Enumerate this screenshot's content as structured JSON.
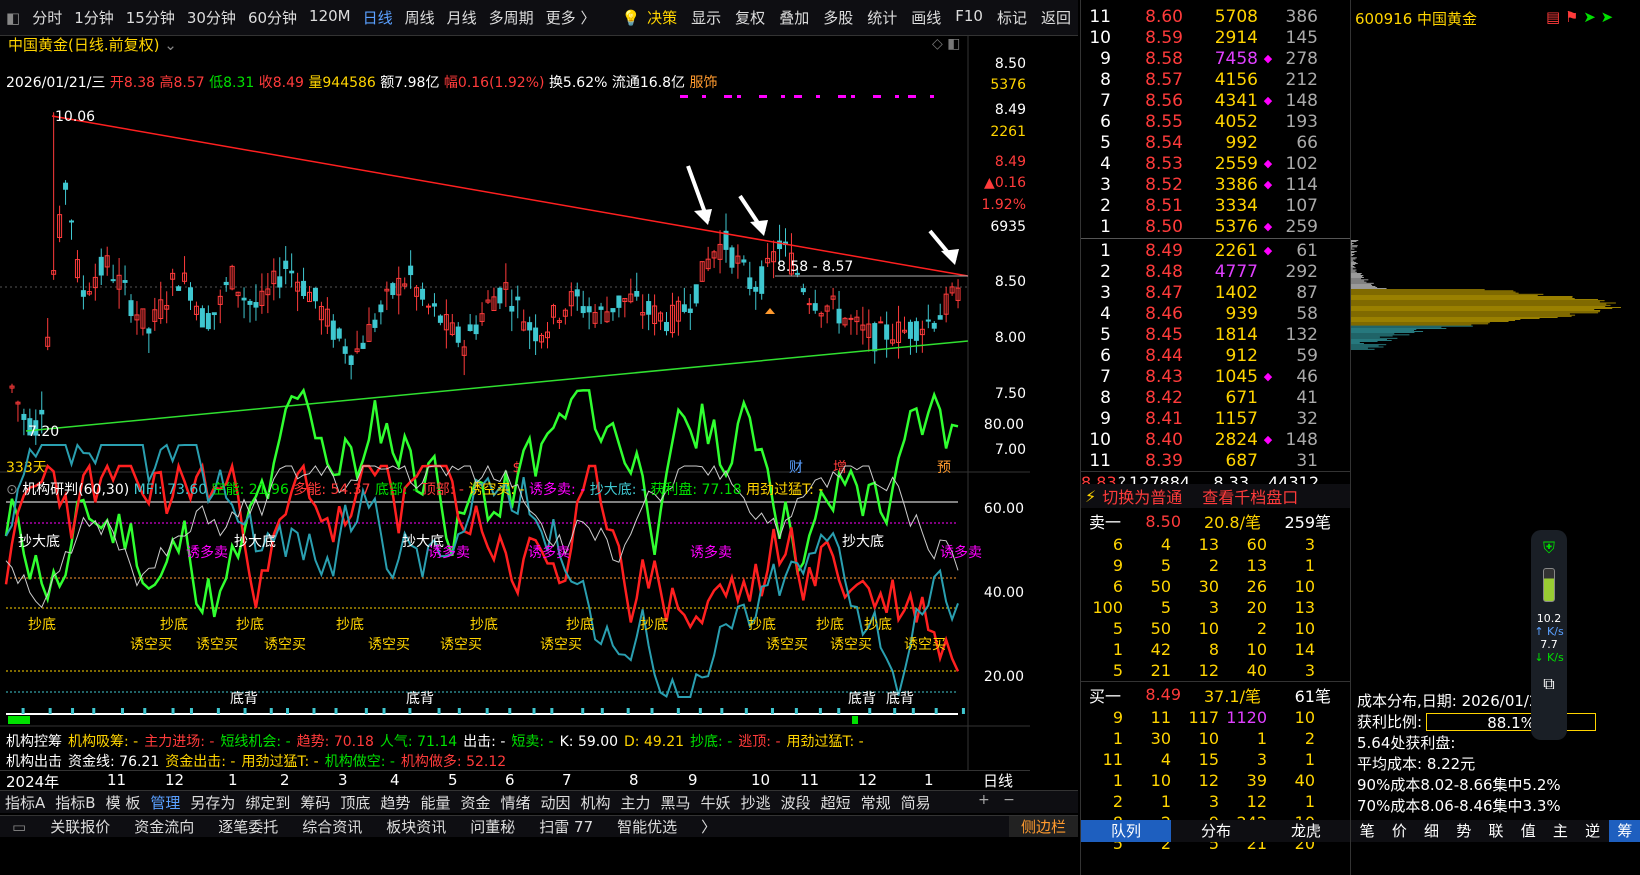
{
  "toolbar": {
    "periods": [
      "分时",
      "1分钟",
      "15分钟",
      "30分钟",
      "60分钟",
      "120M",
      "日线",
      "周线",
      "月线",
      "多周期",
      "更多 〉"
    ],
    "active": "日线",
    "right": [
      "决策",
      "显示",
      "复权",
      "叠加",
      "多股",
      "统计",
      "画线",
      "F10",
      "标记",
      "返回"
    ]
  },
  "chart_title": "中国黄金(日线.前复权)",
  "ohlc": {
    "date": "2026/01/21/三",
    "open": "开8.38",
    "high": "高8.57",
    "low": "低8.31",
    "close": "收8.49",
    "vol": "量944586",
    "amt": "额7.98亿",
    "chg": "幅0.16(1.92%)",
    "turn": "换5.62%",
    "float": "流通16.8亿",
    "sector": "服饰"
  },
  "annotations": {
    "high": "10.06",
    "low": "7.20",
    "range": "8.58 - 8.57",
    "days": "333天",
    "markers": [
      "$",
      "财",
      "增",
      "预"
    ]
  },
  "price_axis": [
    "8.50",
    "5376",
    "8.49",
    "2261",
    "8.49",
    "▲0.16",
    "1.92%",
    "6935",
    "8.50",
    "8.00",
    "7.50",
    "7.00"
  ],
  "sub1": {
    "name": "机构研判(60,30)",
    "mfi": "MFI: 73.60",
    "kong": "空能: 21.96",
    "duo": "多能: 54.37",
    "di": "底部: -",
    "ding": "顶部: -",
    "ykm": "诱空买: -",
    "ydm": "诱多卖: -",
    "cdd": "抄大底: -",
    "hlp": "获利盘: 77.18",
    "ygm": "用劲过猛T: -",
    "axis": [
      "80.00",
      "60.00",
      "40.00",
      "20.00"
    ],
    "labels": {
      "cdd": "抄大底",
      "ydm": "诱多卖",
      "cd": "抄底",
      "ykm": "诱空买",
      "db": "底背"
    }
  },
  "sub2": {
    "l1": [
      "机构控筹",
      "机构吸筹: -",
      "主力进场: -",
      "短线机会: -",
      "趋势: 70.18",
      "人气: 71.14",
      "出击: -",
      "短卖: -",
      "K: 59.00",
      "D: 49.21",
      "抄底: -",
      "逃顶: -",
      "用劲过猛T: -"
    ],
    "l2": [
      "机构出击",
      "资金线: 76.21",
      "资金出击: -",
      "用劲过猛T: -",
      "机构做空: -",
      "机构做多: 52.12"
    ]
  },
  "time_axis": [
    "2024年",
    "11",
    "12",
    "1",
    "2",
    "3",
    "4",
    "5",
    "6",
    "7",
    "8",
    "9",
    "10",
    "11",
    "12",
    "1"
  ],
  "period_label": "日线",
  "bottom_tabs": [
    "指标A",
    "指标B",
    "模 板",
    "管理",
    "另存为",
    "绑定到",
    "筹码",
    "顶底",
    "趋势",
    "能量",
    "资金",
    "情绪",
    "动因",
    "机构",
    "主力",
    "黑马",
    "牛妖",
    "抄逃",
    "波段",
    "超短",
    "常规",
    "简易"
  ],
  "bottom_bar": [
    "关联报价",
    "资金流向",
    "逐笔委托",
    "综合资讯",
    "板块资讯",
    "问董秘",
    "扫雷 77",
    "智能优选",
    "〉",
    "侧边栏"
  ],
  "asks": [
    [
      "11",
      "8.60",
      "5708",
      "",
      "386"
    ],
    [
      "10",
      "8.59",
      "2914",
      "",
      "145"
    ],
    [
      "9",
      "8.58",
      "7458",
      "◆",
      "278"
    ],
    [
      "8",
      "8.57",
      "4156",
      "",
      "212"
    ],
    [
      "7",
      "8.56",
      "4341",
      "◆",
      "148"
    ],
    [
      "6",
      "8.55",
      "4052",
      "",
      "193"
    ],
    [
      "5",
      "8.54",
      "992",
      "",
      "66"
    ],
    [
      "4",
      "8.53",
      "2559",
      "◆",
      "102"
    ],
    [
      "3",
      "8.52",
      "3386",
      "◆",
      "114"
    ],
    [
      "2",
      "8.51",
      "3334",
      "",
      "107"
    ],
    [
      "1",
      "8.50",
      "5376",
      "◆",
      "259"
    ]
  ],
  "bids": [
    [
      "1",
      "8.49",
      "2261",
      "◆",
      "61"
    ],
    [
      "2",
      "8.48",
      "4777",
      "",
      "292"
    ],
    [
      "3",
      "8.47",
      "1402",
      "",
      "87"
    ],
    [
      "4",
      "8.46",
      "939",
      "",
      "58"
    ],
    [
      "5",
      "8.45",
      "1814",
      "",
      "132"
    ],
    [
      "6",
      "8.44",
      "912",
      "",
      "59"
    ],
    [
      "7",
      "8.43",
      "1045",
      "◆",
      "46"
    ],
    [
      "8",
      "8.42",
      "671",
      "",
      "41"
    ],
    [
      "9",
      "8.41",
      "1157",
      "",
      "32"
    ],
    [
      "10",
      "8.40",
      "2824",
      "◆",
      "148"
    ],
    [
      "11",
      "8.39",
      "687",
      "",
      "31"
    ]
  ],
  "book_footer": [
    "8.83",
    "?",
    "127884",
    "8.33",
    "44312"
  ],
  "switch": {
    "a": "切换为普通",
    "b": "查看千档盘口"
  },
  "sell1": {
    "label": "卖一",
    "price": "8.50",
    "per": "20.8/笔",
    "cnt": "259笔"
  },
  "sell_rows": [
    [
      "6",
      "4",
      "13",
      "60",
      "3"
    ],
    [
      "9",
      "5",
      "2",
      "13",
      "1"
    ],
    [
      "6",
      "50",
      "30",
      "26",
      "10"
    ],
    [
      "100",
      "5",
      "3",
      "20",
      "13"
    ],
    [
      "5",
      "50",
      "10",
      "2",
      "10"
    ],
    [
      "1",
      "42",
      "8",
      "10",
      "14"
    ],
    [
      "5",
      "21",
      "12",
      "40",
      "3"
    ]
  ],
  "buy1": {
    "label": "买一",
    "price": "8.49",
    "per": "37.1/笔",
    "cnt": "61笔"
  },
  "buy_rows": [
    [
      "9",
      "11",
      "117",
      "1120",
      "10"
    ],
    [
      "1",
      "30",
      "10",
      "1",
      "2"
    ],
    [
      "11",
      "4",
      "15",
      "3",
      "1"
    ],
    [
      "1",
      "10",
      "12",
      "39",
      "40"
    ],
    [
      "2",
      "1",
      "3",
      "12",
      "1"
    ],
    [
      "8",
      "2",
      "9",
      "242",
      "10"
    ],
    [
      "5",
      "2",
      "5",
      "21",
      "20"
    ]
  ],
  "detail_tabs": [
    "队列",
    "分布",
    "龙虎"
  ],
  "stock": {
    "code": "600916",
    "name": "中国黄金"
  },
  "cost": {
    "date": "成本分布,日期:  2026/01/21",
    "profit_label": "获利比例:",
    "profit": "88.1%",
    "profit_pct": 88.1,
    "p1": "5.64处获利盘:",
    "p2": "平均成本:  8.22元",
    "p3": "90%成本8.02-8.66集中5.2%",
    "p4": "70%成本8.06-8.46集中3.3%"
  },
  "speed": {
    "up": "10.2",
    "down": "7.7",
    "unit": "K/s"
  },
  "right_tabs": [
    "笔",
    "价",
    "细",
    "势",
    "联",
    "值",
    "主",
    "逆",
    "筹"
  ]
}
